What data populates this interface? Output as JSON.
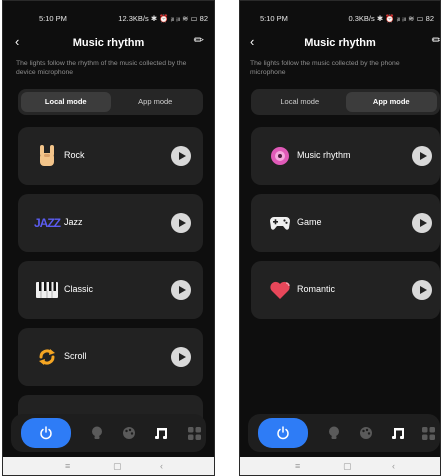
{
  "left": {
    "status": {
      "time": "5:10 PM",
      "network": "12.3KB/s ✱ ⏰ ᵢₗₗ ᵢₗₗ ≋ ▭ 82"
    },
    "title": "Music rhythm",
    "description": "The lights follow the rhythm of the music collected by the device microphone",
    "modes": [
      {
        "label": "Local mode",
        "active": true
      },
      {
        "label": "App mode",
        "active": false
      }
    ],
    "cards": [
      {
        "label": "Rock",
        "icon": "rock-hand-icon"
      },
      {
        "label": "Jazz",
        "icon": "jazz-text-icon",
        "icon_text": "JAZZ"
      },
      {
        "label": "Classic",
        "icon": "piano-keys-icon"
      },
      {
        "label": "Scroll",
        "icon": "scroll-arrows-icon"
      }
    ]
  },
  "right": {
    "status": {
      "time": "5:10 PM",
      "network": "0.3KB/s ✱ ⏰ ᵢₗₗ ᵢₗₗ ≋ ▭ 82"
    },
    "title": "Music rhythm",
    "description": "The lights follow the music collected by the phone microphone",
    "modes": [
      {
        "label": "Local mode",
        "active": false
      },
      {
        "label": "App mode",
        "active": true
      }
    ],
    "cards": [
      {
        "label": "Music rhythm",
        "icon": "vinyl-record-icon"
      },
      {
        "label": "Game",
        "icon": "gamepad-icon"
      },
      {
        "label": "Romantic",
        "icon": "heart-icon"
      }
    ]
  },
  "nav_icons": [
    "power-icon",
    "bulb-icon",
    "palette-icon",
    "music-note-icon",
    "grid-icon"
  ],
  "colors": {
    "accent": "#2e7cf6",
    "background": "#0e0e0e",
    "card": "#222222"
  }
}
